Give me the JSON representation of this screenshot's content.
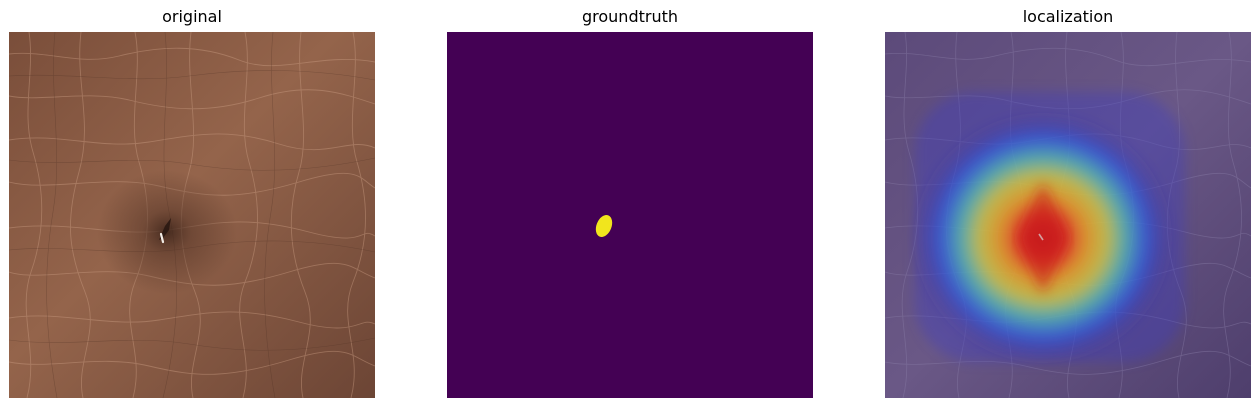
{
  "panels": {
    "original": {
      "title": "original"
    },
    "groundtruth": {
      "title": "groundtruth"
    },
    "localization": {
      "title": "localization"
    }
  },
  "colors": {
    "leather_base": "#8a5c44",
    "leather_light": "#9c6a50",
    "leather_dark": "#6e4634",
    "mask_background": "#440154",
    "mask_foreground": "#f1e51d",
    "heatmap_cool": "#2a2a9a",
    "heatmap_hot": "#e0201a"
  },
  "icons": {
    "defect": "defect-mark-icon"
  }
}
